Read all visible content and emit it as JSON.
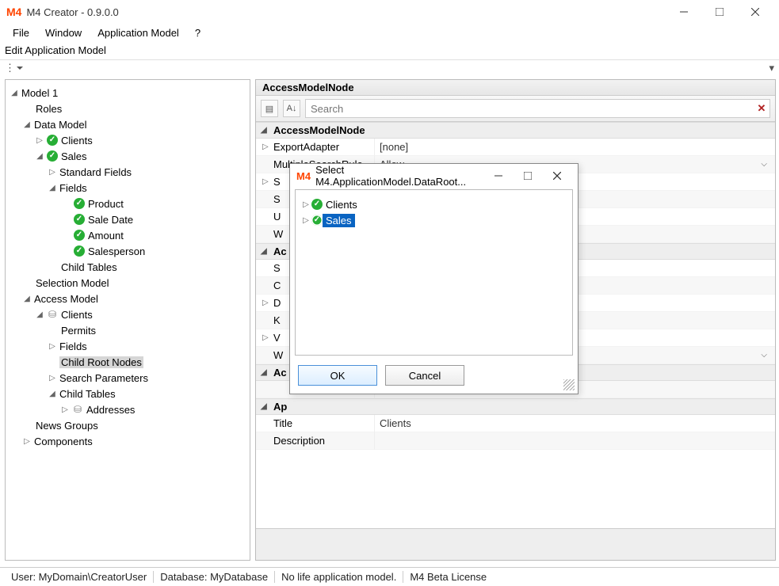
{
  "window": {
    "title": "M4 Creator - 0.9.0.0",
    "logo": "M4"
  },
  "menu": {
    "items": [
      "File",
      "Window",
      "Application Model",
      "?"
    ]
  },
  "toolstrip": {
    "label": "Edit Application Model"
  },
  "tree": {
    "root": "Model 1",
    "roles": "Roles",
    "dataModel": "Data Model",
    "clients": "Clients",
    "sales": "Sales",
    "standardFields": "Standard Fields",
    "fields": "Fields",
    "product": "Product",
    "saleDate": "Sale Date",
    "amount": "Amount",
    "salesperson": "Salesperson",
    "childTables": "Child Tables",
    "selectionModel": "Selection Model",
    "accessModel": "Access Model",
    "amClients": "Clients",
    "permits": "Permits",
    "amFields": "Fields",
    "childRootNodes": "Child Root Nodes",
    "searchParams": "Search Parameters",
    "childTables2": "Child Tables",
    "addresses": "Addresses",
    "newsGroups": "News Groups",
    "components": "Components"
  },
  "panel": {
    "header": "AccessModelNode",
    "searchPlaceholder": "Search",
    "cat1": "AccessModelNode",
    "exportAdapter": {
      "label": "ExportAdapter",
      "value": "[none]"
    },
    "multipleSearchRule": {
      "label": "MultipleSearchRule",
      "value": "Allow"
    },
    "partial": {
      "S": "S",
      "S2": "S",
      "U": "U",
      "W": "W"
    },
    "cat2": "Ac",
    "row_S": "S",
    "row_C": "C",
    "row_D": "D",
    "row_K": "K",
    "row_V": "V",
    "row_W": "W",
    "cat3": "Ac",
    "cat4": "Ap",
    "title": {
      "label": "Title",
      "value": "Clients"
    },
    "description": {
      "label": "Description",
      "value": ""
    }
  },
  "dialog": {
    "title": "Select M4.ApplicationModel.DataRoot...",
    "items": {
      "clients": "Clients",
      "sales": "Sales"
    },
    "ok": "OK",
    "cancel": "Cancel"
  },
  "status": {
    "user": "User: MyDomain\\CreatorUser",
    "db": "Database: MyDatabase",
    "life": "No life application model.",
    "lic": "M4 Beta License"
  }
}
